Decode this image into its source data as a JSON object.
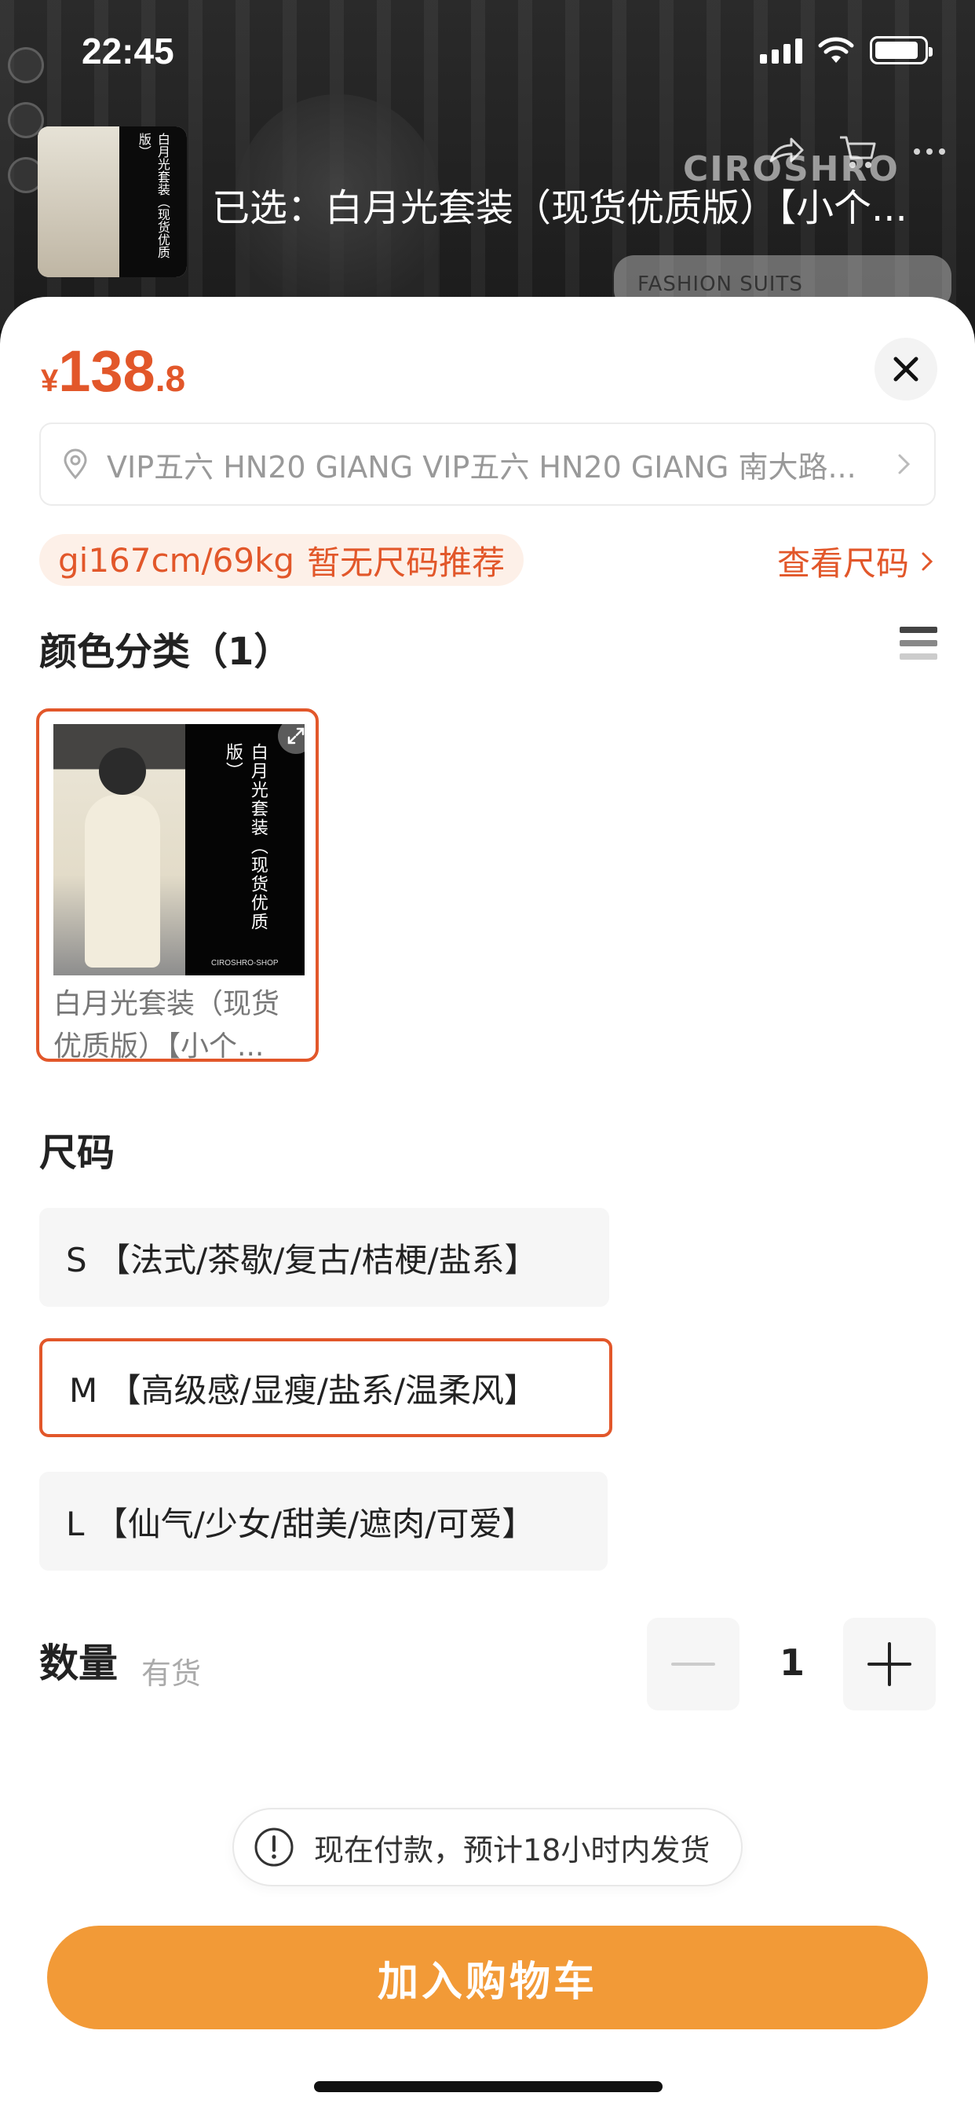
{
  "status_bar": {
    "time": "22:45"
  },
  "header": {
    "selected_text": "已选：白月光套装（现货优质版）【小个...",
    "thumbnail_vertical_text": "白月光套装（现货优质版）",
    "background_watermark": "CIROSHRO",
    "background_card_text": "FASHION SUITS"
  },
  "sheet": {
    "price": {
      "currency": "¥",
      "integer": "138",
      "decimal": ".8",
      "color": "#e2572a"
    },
    "address": {
      "text": "VIP五六 HN20 GIANG VIP五六 HN20 GIANG 南大路..."
    },
    "size_recommendation": {
      "body_info": "gi167cm/69kg",
      "note": "暂无尺码推荐",
      "view_size_label": "查看尺码"
    },
    "color_section": {
      "title": "颜色分类（1）",
      "options": [
        {
          "caption": "白月光套装（现货优质版）【小个...",
          "poster_text": "白月光套装（现货优质版）",
          "shop_text": "CIROSHRO-SHOP",
          "selected": true
        }
      ]
    },
    "size_section": {
      "title": "尺码",
      "options": [
        {
          "label": "S 【法式/茶歇/复古/桔梗/盐系】",
          "selected": false
        },
        {
          "label": "M 【高级感/显瘦/盐系/温柔风】",
          "selected": true
        },
        {
          "label": "L 【仙气/少女/甜美/遮肉/可爱】",
          "selected": false
        }
      ]
    },
    "quantity": {
      "label": "数量",
      "stock": "有货",
      "value": "1"
    },
    "shipping_note": "现在付款，预计18小时内发货",
    "add_to_cart_label": "加入购物车"
  },
  "colors": {
    "accent": "#e2572a",
    "button": "#f29a37"
  }
}
